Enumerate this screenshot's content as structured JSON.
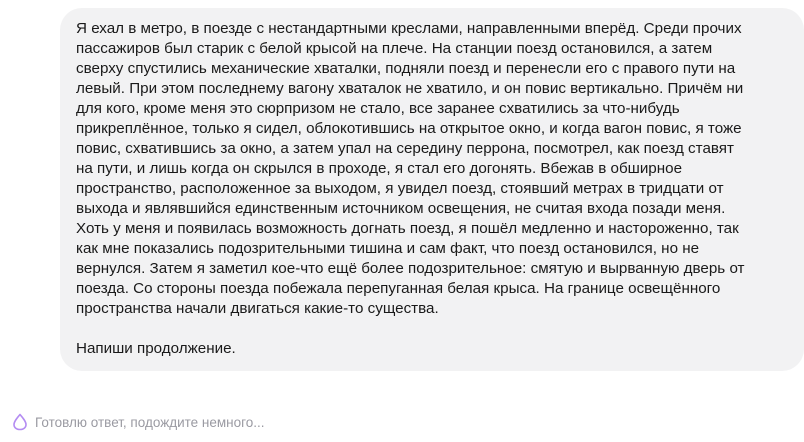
{
  "message": {
    "lines": [
      "Я ехал в метро, в поезде с нестандартными креслами, направленными вперёд. Среди прочих",
      "пассажиров был старик с белой крысой на плече. На станции поезд остановился, а затем",
      "сверху спустились механические хваталки, подняли поезд и перенесли его с правого пути на",
      "левый. При этом последнему вагону хваталок не хватило, и он повис вертикально. Причём ни",
      "для кого, кроме меня это сюрпризом не стало, все заранее схватились за что-нибудь",
      "прикреплённое, только я сидел, облокотившись на открытое окно, и когда вагон повис, я тоже",
      "повис, схватившись за окно, а затем упал на середину перрона, посмотрел, как поезд ставят",
      "на пути, и лишь когда он скрылся в проходе, я стал его догонять. Вбежав в обширное",
      "пространство, расположенное за выходом, я увидел поезд, стоявший метрах в тридцати от",
      "выхода и являвшийся единственным источником освещения, не считая входа позади меня.",
      "Хоть у меня и появилась возможность догнать поезд, я пошёл медленно и настороженно, так",
      "как мне показались подозрительными тишина и сам факт, что поезд остановился, но не",
      "вернулся. Затем я заметил кое-что ещё более подозрительное: смятую и вырванную дверь от",
      "поезда. Со стороны поезда побежала перепуганная белая крыса. На границе освещённого",
      "пространства начали двигаться какие-то существа."
    ],
    "prompt": "Напиши продолжение."
  },
  "status": {
    "icon": "assistant-logo-icon",
    "text": "Готовлю ответ, подождите немного..."
  },
  "colors": {
    "bubble_background": "#f2f2f3",
    "text": "#1a1a1a",
    "status_text": "#9a9aa2",
    "icon_accent": "#b48cf2"
  }
}
